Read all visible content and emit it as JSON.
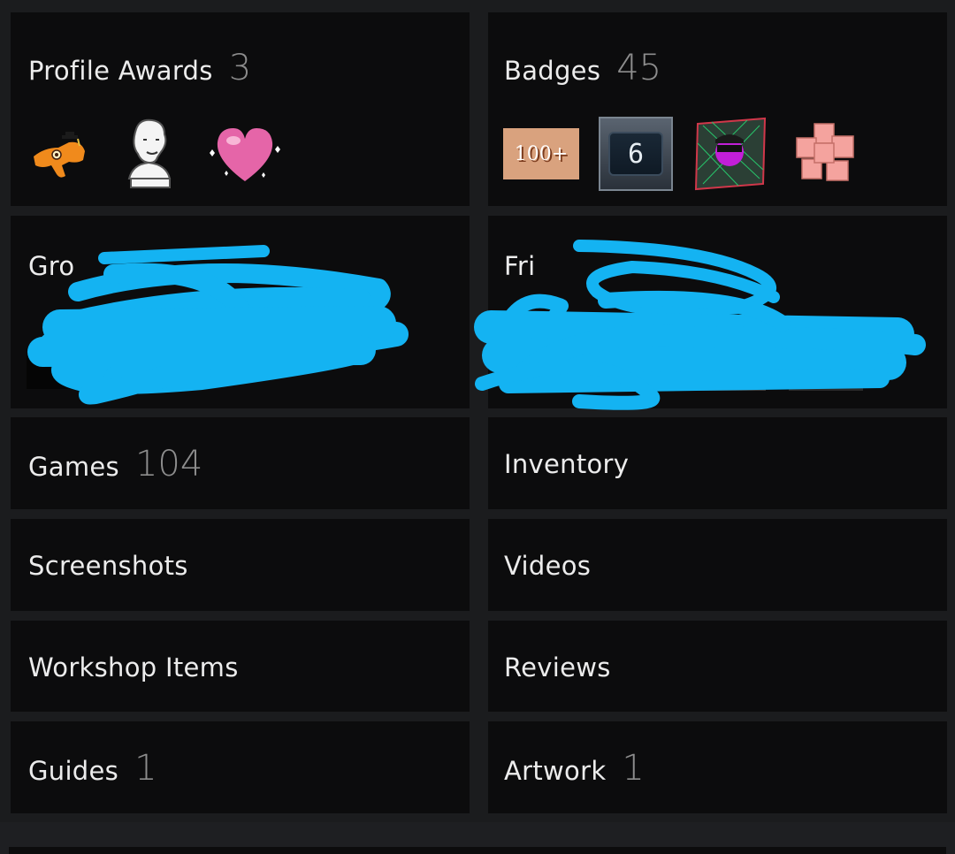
{
  "panels": {
    "profile_awards": {
      "label": "Profile Awards",
      "count": "3"
    },
    "badges": {
      "label": "Badges",
      "count": "45"
    },
    "groups": {
      "label": "Gro"
    },
    "friends": {
      "label": "Fri"
    },
    "games": {
      "label": "Games",
      "count": "104"
    },
    "inventory": {
      "label": "Inventory"
    },
    "screenshots": {
      "label": "Screenshots"
    },
    "videos": {
      "label": "Videos"
    },
    "workshop_items": {
      "label": "Workshop Items"
    },
    "reviews": {
      "label": "Reviews"
    },
    "guides": {
      "label": "Guides",
      "count": "1"
    },
    "artwork": {
      "label": "Artwork",
      "count": "1"
    }
  },
  "awards_icons": [
    "dinosaur-icon",
    "bust-icon",
    "heart-icon"
  ],
  "badge_icons": [
    "badge-100-icon",
    "badge-6-icon",
    "badge-portrait-icon",
    "badge-flower-icon"
  ],
  "badge_100_text": "100+",
  "badge_6_text": "6",
  "colors": {
    "panel_bg": "#0c0c0d",
    "page_bg": "#1b1c1e",
    "label_text": "#ececec",
    "count_text": "#8d8d8d",
    "scribble": "#14b3f2"
  }
}
